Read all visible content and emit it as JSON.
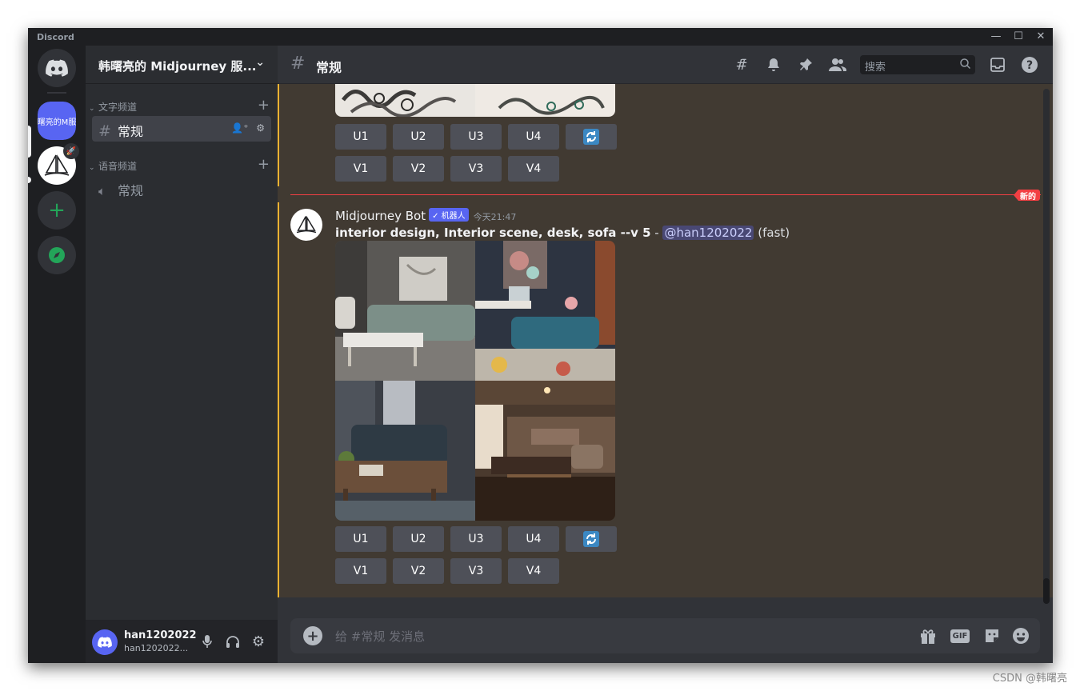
{
  "window": {
    "app_name": "Discord"
  },
  "server": {
    "name": "韩曙亮的 Midjourney 服...",
    "short_name": "韩曙亮的M服务"
  },
  "sidebar": {
    "text_category": "文字频道",
    "voice_category": "语音频道",
    "text_channels": [
      {
        "label": "常规"
      }
    ],
    "voice_channels": [
      {
        "label": "常规"
      }
    ]
  },
  "user": {
    "name": "han1202022",
    "tag": "han1202022..."
  },
  "header": {
    "channel_name": "常规",
    "search_placeholder": "搜索"
  },
  "messages": {
    "prev": {
      "upscale_buttons": [
        "U1",
        "U2",
        "U3",
        "U4"
      ],
      "variation_buttons": [
        "V1",
        "V2",
        "V3",
        "V4"
      ]
    },
    "new_divider_label": "新的",
    "current": {
      "author": "Midjourney Bot",
      "bot_badge": "✓ 机器人",
      "timestamp": "今天21:47",
      "prompt": "interior design, Interior scene, desk, sofa --v 5",
      "separator": " - ",
      "mention": "@han1202022",
      "speed": " (fast)",
      "upscale_buttons": [
        "U1",
        "U2",
        "U3",
        "U4"
      ],
      "variation_buttons": [
        "V1",
        "V2",
        "V3",
        "V4"
      ]
    }
  },
  "composer": {
    "placeholder": "给 #常规 发消息",
    "gif_label": "GIF"
  },
  "watermark": "CSDN @韩曙亮",
  "colors": {
    "blurple": "#5865f2",
    "highlight": "#f0b232",
    "new_red": "#f23f43",
    "message_highlight_bg": "#413a32"
  }
}
